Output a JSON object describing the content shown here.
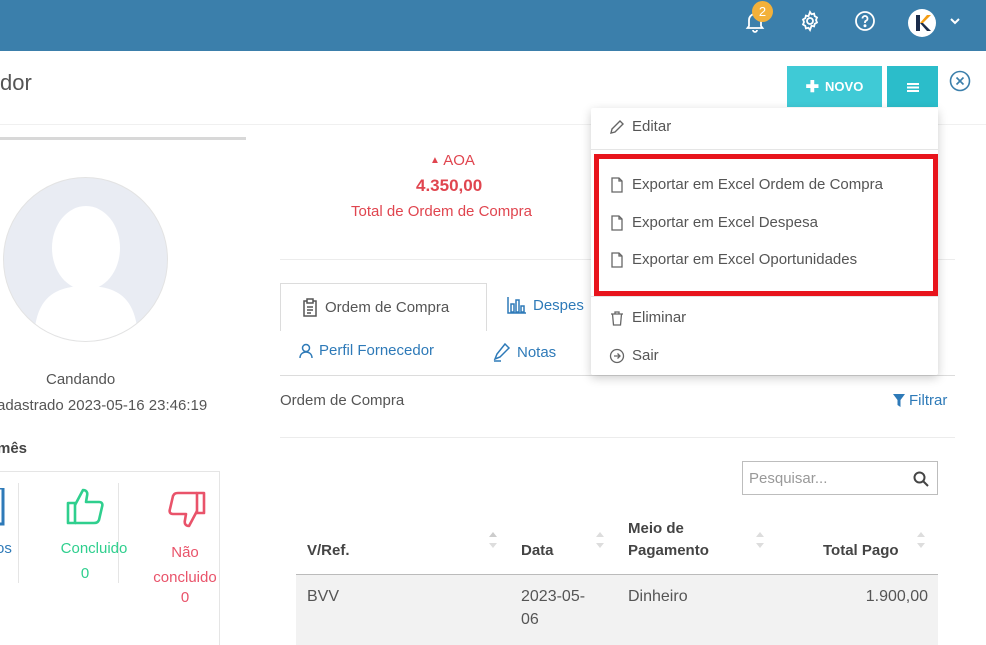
{
  "topbar": {
    "notification_count": "2",
    "icons": [
      "bell-icon",
      "gear-icon",
      "help-icon",
      "user-avatar",
      "chevron-down-icon"
    ],
    "color": "#3b7fab"
  },
  "header": {
    "title": "dor",
    "new_button": "NOVO"
  },
  "profile": {
    "name": "Candando",
    "registered": "adastrado 2023-05-16 23:46:19",
    "month_label": "mês",
    "stats": [
      {
        "label": "os",
        "value": ""
      },
      {
        "label": "Concluido",
        "value": "0",
        "color": "#2fcf8e"
      },
      {
        "label": "Não concluido",
        "value": "0",
        "color": "#e9536a"
      }
    ]
  },
  "summary": {
    "currency": "AOA",
    "amount": "4.350,00",
    "label": "Total de Ordem de Compra",
    "color": "#e0454f"
  },
  "tabs": [
    {
      "label": "Ordem de Compra",
      "icon": "document-icon"
    },
    {
      "label": "Despes",
      "icon": "chart-icon"
    },
    {
      "label": "Perfil Fornecedor",
      "icon": "person-icon"
    },
    {
      "label": "Notas",
      "icon": "pen-icon"
    }
  ],
  "content": {
    "section_title": "Ordem de Compra",
    "filter_label": "Filtrar",
    "search_placeholder": "Pesquisar...",
    "table": {
      "columns": [
        "V/Ref.",
        "Data",
        "Meio de Pagamento",
        "Total Pago"
      ],
      "rows": [
        {
          "ref": "BVV",
          "date": "2023-05-06",
          "method": "Dinheiro",
          "total": "1.900,00"
        }
      ]
    }
  },
  "dropdown": {
    "items": [
      {
        "label": "Editar",
        "icon": "pencil-icon"
      },
      {
        "label": "Exportar em Excel Ordem de Compra",
        "icon": "file-icon"
      },
      {
        "label": "Exportar em Excel Despesa",
        "icon": "file-icon"
      },
      {
        "label": "Exportar em Excel Oportunidades",
        "icon": "file-icon"
      },
      {
        "label": "Eliminar",
        "icon": "trash-icon"
      },
      {
        "label": "Sair",
        "icon": "exit-icon"
      }
    ],
    "highlight_color": "#e8141c"
  }
}
